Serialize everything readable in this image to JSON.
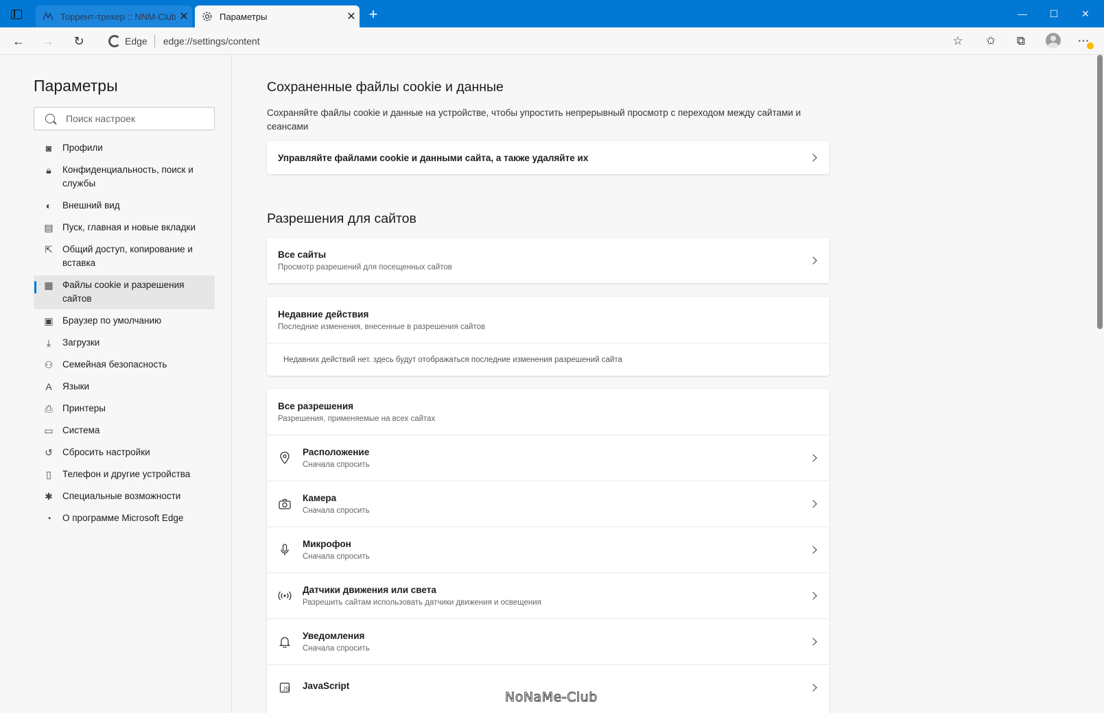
{
  "tabs": [
    {
      "title": "Торрент-трекер :: NNM-Club",
      "favicon": "nnm-club-favicon",
      "active": false
    },
    {
      "title": "Параметры",
      "favicon": "gear-icon",
      "active": true
    }
  ],
  "address": {
    "brand": "Edge",
    "url": "edge://settings/content"
  },
  "sidebar": {
    "title": "Параметры",
    "search_placeholder": "Поиск настроек",
    "items": [
      {
        "label": "Профили",
        "icon": "profile-icon"
      },
      {
        "label": "Конфиденциальность, поиск и службы",
        "icon": "lock-icon"
      },
      {
        "label": "Внешний вид",
        "icon": "palette-icon"
      },
      {
        "label": "Пуск, главная и новые вкладки",
        "icon": "home-tabs-icon"
      },
      {
        "label": "Общий доступ, копирование и вставка",
        "icon": "share-icon"
      },
      {
        "label": "Файлы cookie и разрешения сайтов",
        "icon": "cookie-permissions-icon",
        "active": true
      },
      {
        "label": "Браузер по умолчанию",
        "icon": "default-browser-icon"
      },
      {
        "label": "Загрузки",
        "icon": "download-icon"
      },
      {
        "label": "Семейная безопасность",
        "icon": "family-icon"
      },
      {
        "label": "Языки",
        "icon": "languages-icon"
      },
      {
        "label": "Принтеры",
        "icon": "printer-icon"
      },
      {
        "label": "Система",
        "icon": "system-icon"
      },
      {
        "label": "Сбросить настройки",
        "icon": "reset-icon"
      },
      {
        "label": "Телефон и другие устройства",
        "icon": "phone-icon"
      },
      {
        "label": "Специальные возможности",
        "icon": "accessibility-icon"
      },
      {
        "label": "О программе Microsoft Edge",
        "icon": "edge-logo-icon"
      }
    ]
  },
  "main": {
    "cookies": {
      "title": "Сохраненные файлы cookie и данные",
      "description": "Сохраняйте файлы cookie и данные на устройстве, чтобы упростить непрерывный просмотр с переходом между сайтами и сеансами",
      "manage_label": "Управляйте файлами cookie и данными сайта, а также удаляйте их"
    },
    "permissions": {
      "title": "Разрешения для сайтов",
      "all_sites": {
        "title": "Все сайты",
        "subtitle": "Просмотр разрешений для посещенных сайтов"
      },
      "recent": {
        "title": "Недавние действия",
        "subtitle": "Последние изменения, внесенные в разрешения сайтов",
        "empty": "Недавних действий нет. здесь будут отображаться последние изменения разрешений сайта"
      },
      "all_permissions": {
        "title": "Все разрешения",
        "subtitle": "Разрешения, применяемые на всех сайтах"
      },
      "items": [
        {
          "title": "Расположение",
          "subtitle": "Сначала спросить",
          "icon": "location-icon"
        },
        {
          "title": "Камера",
          "subtitle": "Сначала спросить",
          "icon": "camera-icon"
        },
        {
          "title": "Микрофон",
          "subtitle": "Сначала спросить",
          "icon": "microphone-icon"
        },
        {
          "title": "Датчики движения или света",
          "subtitle": "Разрешить сайтам использовать датчики движения и освещения",
          "icon": "sensors-icon"
        },
        {
          "title": "Уведомления",
          "subtitle": "Сначала спросить",
          "icon": "bell-icon"
        },
        {
          "title": "JavaScript",
          "subtitle": "",
          "icon": "javascript-icon"
        }
      ]
    }
  },
  "watermark": "NoNaMe-Club",
  "colors": {
    "accent": "#0078d4",
    "titlebar": "#0078d4",
    "background": "#f7f7f7"
  }
}
